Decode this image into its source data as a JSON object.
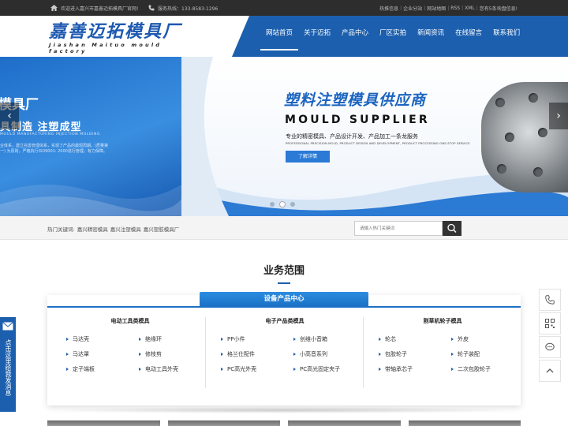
{
  "topbar": {
    "welcome": "欢迎进入嘉兴市嘉善迈拓模具厂官网!",
    "hotline": "服务热线：133-8583-1296",
    "links": [
      "热推信息",
      "企业分站",
      "网站地图",
      "RSS",
      "XML",
      "您有5条询盘信息!"
    ]
  },
  "logo": {
    "cn": "嘉善迈拓模具厂",
    "en": "Jiashan Maituo mould factory"
  },
  "nav": [
    "网站首页",
    "关于迈拓",
    "产品中心",
    "厂区实拍",
    "新闻资讯",
    "在线留言",
    "联系我们"
  ],
  "banner": {
    "left_slide": {
      "title": "模具厂",
      "subtitle": "具制造 注塑成型",
      "en": "MOULD MANUFACTURING INJECTION MOLDING",
      "desc": "业体系，建立完善管理体系，实现了产品的最短周期。(质量第一) 为原则，严格执行ISO9001: 2000进行管理，有力保障。"
    },
    "main_slide": {
      "title": "塑料注塑模具供应商",
      "en_title": "MOULD SUPPLIER",
      "desc": "专业的精密模具、产品设计开发、产品加工一条龙服务",
      "en_desc": "PROFESSIONAL PRECISION MOLD, PRODUCT DESIGN AND DEVELOPMENT, PRODUCT PROCESSING ONE-STOP SERVICE",
      "button": "了解详情"
    },
    "prev": "‹",
    "next": "›",
    "active_dot": 1,
    "dot_count": 3
  },
  "hot": {
    "label": "热门关键词:",
    "keywords": [
      "嘉兴精密模具",
      "嘉兴注塑模具",
      "嘉兴塑胶模具厂"
    ]
  },
  "search": {
    "placeholder": "请输入热门关键词"
  },
  "section": {
    "title": "业务范围",
    "ribbon": "设备产品中心",
    "columns": [
      {
        "title": "电动工具类模具",
        "items": [
          "马达壳",
          "绝缘环",
          "马达罩",
          "修枝剪",
          "定子端板",
          "电动工具外壳"
        ]
      },
      {
        "title": "电子产品类模具",
        "items": [
          "PP小件",
          "创维小音箱",
          "格兰仕配件",
          "小高音系列",
          "PC高光外壳",
          "PC高光固定夹子"
        ]
      },
      {
        "title": "割草机轮子模具",
        "items": [
          "轮芯",
          "外皮",
          "包胶轮子",
          "轮子装配",
          "带轴承芯子",
          "二次包胶轮子"
        ]
      }
    ]
  },
  "consult": {
    "label": "点击这里给我发消息"
  },
  "colors": {
    "brand_blue": "#1c5fae",
    "topbar_bg": "#2d2d2d"
  }
}
